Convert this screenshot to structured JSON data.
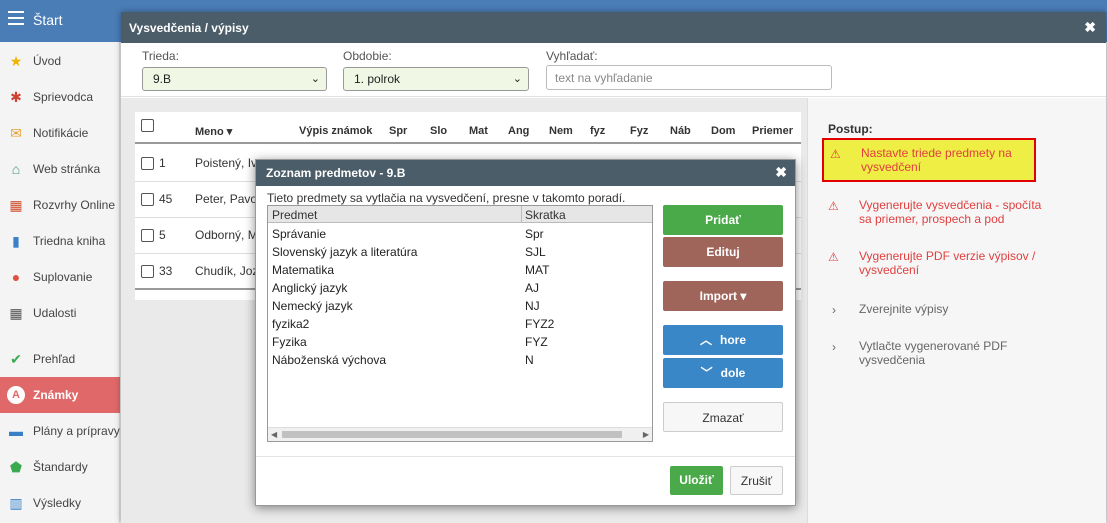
{
  "app": {
    "title": "Štart"
  },
  "sidebar": {
    "items": [
      {
        "label": "Úvod",
        "icon": "star-icon"
      },
      {
        "label": "Sprievodca",
        "icon": "wand-icon"
      },
      {
        "label": "Notifikácie",
        "icon": "envelope-icon"
      },
      {
        "label": "Web stránka",
        "icon": "home-icon"
      },
      {
        "label": "Rozvrhy Online",
        "icon": "calendar-icon"
      },
      {
        "label": "Triedna kniha",
        "icon": "book-icon"
      },
      {
        "label": "Suplovanie",
        "icon": "person-icon"
      },
      {
        "label": "Udalosti",
        "icon": "calendar-grid-icon"
      },
      {
        "label": "Prehľad",
        "icon": "check-circle-icon"
      },
      {
        "label": "Známky",
        "icon": "grade-icon"
      },
      {
        "label": "Plány a prípravy",
        "icon": "briefcase-icon"
      },
      {
        "label": "Štandardy",
        "icon": "shield-icon"
      },
      {
        "label": "Výsledky",
        "icon": "bar-chart-icon"
      }
    ]
  },
  "dialog": {
    "title": "Vysvedčenia / výpisy",
    "trieda_label": "Trieda:",
    "trieda_value": "9.B",
    "obdobie_label": "Obdobie:",
    "obdobie_value": "1. polrok",
    "search_label": "Vyhľadať:",
    "search_placeholder": "text na vyhľadanie"
  },
  "table": {
    "headers": [
      "Meno ▾",
      "Výpis známok",
      "Spr",
      "Slo",
      "Mat",
      "Ang",
      "Nem",
      "fyz",
      "Fyz",
      "Náb",
      "Dom",
      "Priemer"
    ],
    "rows": [
      {
        "num": "1",
        "name": "Poistený, Iv"
      },
      {
        "num": "45",
        "name": "Peter, Pavo"
      },
      {
        "num": "5",
        "name": "Odborný, M"
      },
      {
        "num": "33",
        "name": "Chudík, Joz"
      }
    ]
  },
  "postup": {
    "title": "Postup:",
    "steps": [
      "Nastavte triede predmety na vysvedčení",
      "Vygenerujte vysvedčenia - spočíta sa priemer, prospech a pod",
      "Vygenerujte PDF verzie výpisov / vysvedčení",
      "Zverejnite výpisy",
      "Vytlačte vygenerované PDF vysvedčenia"
    ]
  },
  "subjects_dialog": {
    "title": "Zoznam predmetov - 9.B",
    "description": "Tieto predmety sa vytlačia na vysvedčení, presne v takomto poradí.",
    "col_subject": "Predmet",
    "col_abbr": "Skratka",
    "rows": [
      {
        "subject": "Správanie",
        "abbr": "Spr"
      },
      {
        "subject": "Slovenský jazyk a literatúra",
        "abbr": "SJL"
      },
      {
        "subject": "Matematika",
        "abbr": "MAT"
      },
      {
        "subject": "Anglický jazyk",
        "abbr": "AJ"
      },
      {
        "subject": "Nemecký jazyk",
        "abbr": "NJ"
      },
      {
        "subject": "fyzika2",
        "abbr": "FYZ2"
      },
      {
        "subject": "Fyzika",
        "abbr": "FYZ"
      },
      {
        "subject": "Náboženská výchova",
        "abbr": "N"
      }
    ],
    "btn_add": "Pridať",
    "btn_edit": "Edituj",
    "btn_import": "Import ▾",
    "btn_up": "hore",
    "btn_down": "dole",
    "btn_delete": "Zmazať",
    "btn_save": "Uložiť",
    "btn_cancel": "Zrušiť"
  },
  "colors": {
    "topbar": "#4a7cb6",
    "dialog_header": "#4b5d68",
    "active_menu": "#e06868",
    "warning": "#e04040",
    "highlight": "#eeee44"
  }
}
